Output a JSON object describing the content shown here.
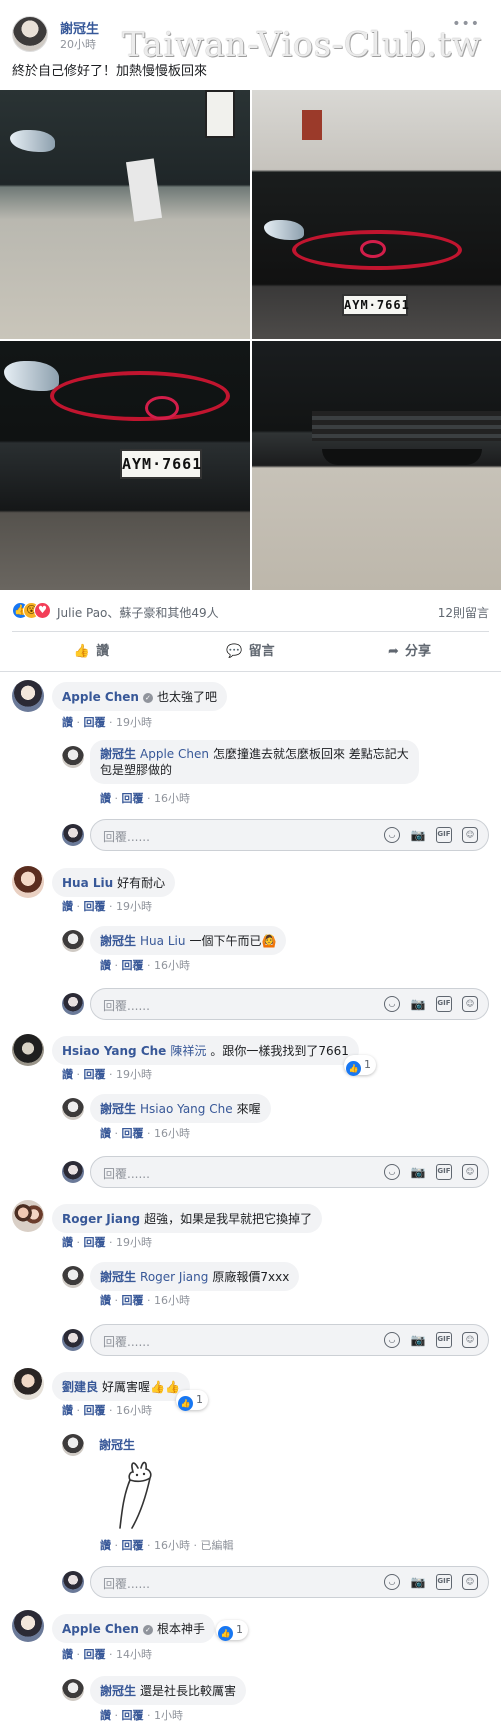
{
  "post": {
    "author": "謝冠生",
    "time": "20小時",
    "text": "終於自己修好了！加熱慢慢板回來",
    "watermark": "Taiwan-Vios-Club.tw",
    "more_icon": "more-dots-icon",
    "photos": [
      {
        "plate": ""
      },
      {
        "plate": "AYM·7661"
      },
      {
        "plate": "AYM·7661"
      },
      {
        "plate": ""
      }
    ]
  },
  "reactions": {
    "names": "Julie Pao、蘇子豪和其他49人",
    "comment_count": "12則留言",
    "icons": [
      "like-icon",
      "wow-icon",
      "love-icon"
    ]
  },
  "actions": [
    {
      "label": "讚",
      "icon": "thumbs-up-icon"
    },
    {
      "label": "留言",
      "icon": "comment-bubble-icon"
    },
    {
      "label": "分享",
      "icon": "share-arrow-icon"
    }
  ],
  "reply_box": {
    "placeholder": "回覆......",
    "icons": [
      "emoji-icon",
      "camera-icon",
      "gif-icon",
      "sticker-icon"
    ],
    "gif_text": "GIF"
  },
  "comments": [
    {
      "name": "Apple Chen",
      "verified": true,
      "text": "也太強了吧",
      "meta": {
        "like": "讚",
        "reply": "回覆",
        "time": "19小時"
      },
      "replies": [
        {
          "name": "謝冠生",
          "mention": "Apple Chen",
          "text_line1": "怎麼撞進去就怎麼板回來 差點忘記大",
          "text_line2": "包是塑膠做的",
          "meta": {
            "like": "讚",
            "reply": "回覆",
            "time": "16小時"
          }
        }
      ]
    },
    {
      "name": "Hua Liu",
      "text": "好有耐心",
      "meta": {
        "like": "讚",
        "reply": "回覆",
        "time": "19小時"
      },
      "replies": [
        {
          "name": "謝冠生",
          "mention": "Hua Liu",
          "text": "一個下午而已🙆",
          "meta": {
            "like": "讚",
            "reply": "回覆",
            "time": "16小時"
          }
        }
      ]
    },
    {
      "name": "Hsiao Yang Che",
      "mention": "陳祥沅",
      "text": "。跟你一樣我找到了7661",
      "like_count": "1",
      "meta": {
        "like": "讚",
        "reply": "回覆",
        "time": "19小時"
      },
      "replies": [
        {
          "name": "謝冠生",
          "mention": "Hsiao Yang Che",
          "text": "來喔",
          "meta": {
            "like": "讚",
            "reply": "回覆",
            "time": "16小時"
          }
        }
      ]
    },
    {
      "name": "Roger Jiang",
      "text": "超強，如果是我早就把它換掉了",
      "meta": {
        "like": "讚",
        "reply": "回覆",
        "time": "19小時"
      },
      "replies": [
        {
          "name": "謝冠生",
          "mention": "Roger Jiang",
          "text": "原廠報價7xxx",
          "meta": {
            "like": "讚",
            "reply": "回覆",
            "time": "16小時"
          }
        }
      ]
    },
    {
      "name": "劉建良",
      "text": "好厲害喔👍👍",
      "like_count": "1",
      "meta": {
        "like": "讚",
        "reply": "回覆",
        "time": "16小時"
      },
      "replies": [
        {
          "name": "謝冠生",
          "sticker": "bunny-sticker",
          "meta": {
            "like": "讚",
            "reply": "回覆",
            "time": "16小時",
            "edited": "已編輯"
          }
        }
      ]
    },
    {
      "name": "Apple Chen",
      "verified": true,
      "text": "根本神手",
      "like_count": "1",
      "meta": {
        "like": "讚",
        "reply": "回覆",
        "time": "14小時"
      },
      "replies": [
        {
          "name": "謝冠生",
          "text": "還是社長比較厲害",
          "meta": {
            "like": "讚",
            "reply": "回覆",
            "time": "1小時"
          }
        }
      ]
    }
  ],
  "colors": {
    "link": "#385898",
    "like_blue": "#1877f2",
    "grille_red": "#c1152f"
  }
}
